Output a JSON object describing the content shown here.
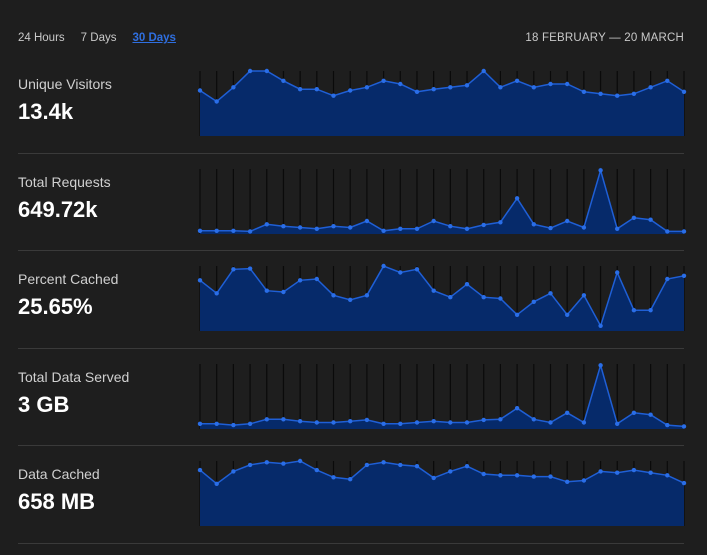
{
  "range_tabs": [
    "24 Hours",
    "7 Days",
    "30 Days"
  ],
  "active_range": "30 Days",
  "date_range": "18 FEBRUARY — 20 MARCH",
  "colors": {
    "background": "#1e1e1e",
    "area_fill": "#062a6a",
    "line": "#1f5fd6",
    "point": "#2a6ee8",
    "active_tab": "#2f6fe0",
    "grid": "#0a0a0a"
  },
  "metrics": [
    {
      "label": "Unique Visitors",
      "value": "13.4k",
      "series": [
        0.7,
        0.53,
        0.75,
        1.0,
        1.0,
        0.85,
        0.72,
        0.72,
        0.62,
        0.7,
        0.75,
        0.85,
        0.8,
        0.68,
        0.72,
        0.75,
        0.78,
        1.0,
        0.75,
        0.85,
        0.75,
        0.8,
        0.8,
        0.68,
        0.65,
        0.62,
        0.65,
        0.75,
        0.85,
        0.68
      ]
    },
    {
      "label": "Total Requests",
      "value": "649.72k",
      "series": [
        0.05,
        0.05,
        0.05,
        0.04,
        0.15,
        0.12,
        0.1,
        0.08,
        0.12,
        0.1,
        0.2,
        0.05,
        0.08,
        0.08,
        0.2,
        0.12,
        0.08,
        0.14,
        0.18,
        0.55,
        0.15,
        0.09,
        0.2,
        0.1,
        0.98,
        0.08,
        0.25,
        0.22,
        0.04,
        0.04
      ]
    },
    {
      "label": "Percent Cached",
      "value": "25.65%",
      "series": [
        0.78,
        0.58,
        0.95,
        0.96,
        0.62,
        0.6,
        0.78,
        0.8,
        0.55,
        0.48,
        0.55,
        1.0,
        0.9,
        0.95,
        0.62,
        0.52,
        0.72,
        0.52,
        0.5,
        0.25,
        0.45,
        0.58,
        0.25,
        0.55,
        0.08,
        0.9,
        0.32,
        0.32,
        0.8,
        0.85
      ]
    },
    {
      "label": "Total Data Served",
      "value": "3 GB",
      "series": [
        0.08,
        0.08,
        0.06,
        0.08,
        0.15,
        0.15,
        0.12,
        0.1,
        0.1,
        0.12,
        0.14,
        0.08,
        0.08,
        0.1,
        0.12,
        0.1,
        0.1,
        0.14,
        0.15,
        0.32,
        0.15,
        0.1,
        0.25,
        0.1,
        0.98,
        0.08,
        0.25,
        0.22,
        0.06,
        0.04
      ]
    },
    {
      "label": "Data Cached",
      "value": "658 MB",
      "series": [
        0.86,
        0.65,
        0.84,
        0.94,
        0.98,
        0.96,
        1.0,
        0.86,
        0.75,
        0.72,
        0.94,
        0.98,
        0.94,
        0.92,
        0.74,
        0.84,
        0.92,
        0.8,
        0.78,
        0.78,
        0.76,
        0.76,
        0.68,
        0.7,
        0.84,
        0.82,
        0.86,
        0.82,
        0.78,
        0.66
      ]
    }
  ]
}
